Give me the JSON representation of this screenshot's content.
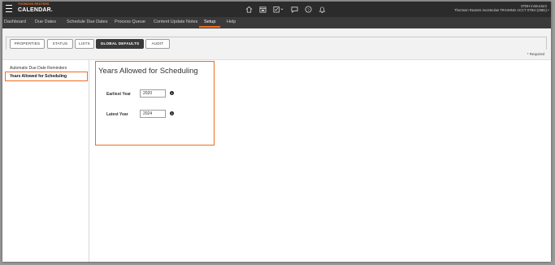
{
  "brand": {
    "company": "THOMSON REUTERS",
    "product": "CALENDAR."
  },
  "header_icons": [
    "home-icon",
    "calendar-icon",
    "checklist-dropdown-icon",
    "chat-icon",
    "help-icon",
    "bell-icon"
  ],
  "user": {
    "name": "STBH Instructor2",
    "org": "Thomson Reuters Incorteolas TRAINING ACCT STBH (2981)"
  },
  "nav": [
    "Dashboard",
    "Due Dates",
    "Schedule Due Dates",
    "Process Queue",
    "Content Update Notes",
    "Setup",
    "Help"
  ],
  "nav_active": "Setup",
  "tabs": [
    "PROPERTIES",
    "STATUS",
    "LISTS",
    "GLOBAL DEFAULTS",
    "AUDIT"
  ],
  "active_tab": "GLOBAL DEFAULTS",
  "required_note": "* Required",
  "left_menu": [
    "Automatic Due Date Reminders",
    "Years Allowed for Scheduling"
  ],
  "left_menu_active": "Years Allowed for Scheduling",
  "main": {
    "title": "Years Allowed for Scheduling",
    "earliest_label": "Earliest Year",
    "earliest_value": "2020",
    "latest_label": "Latest Year",
    "latest_value": "2024"
  },
  "colors": {
    "accent": "#f36c21",
    "header_bg": "#2b2b2b",
    "nav_bg": "#3a3a3a"
  }
}
